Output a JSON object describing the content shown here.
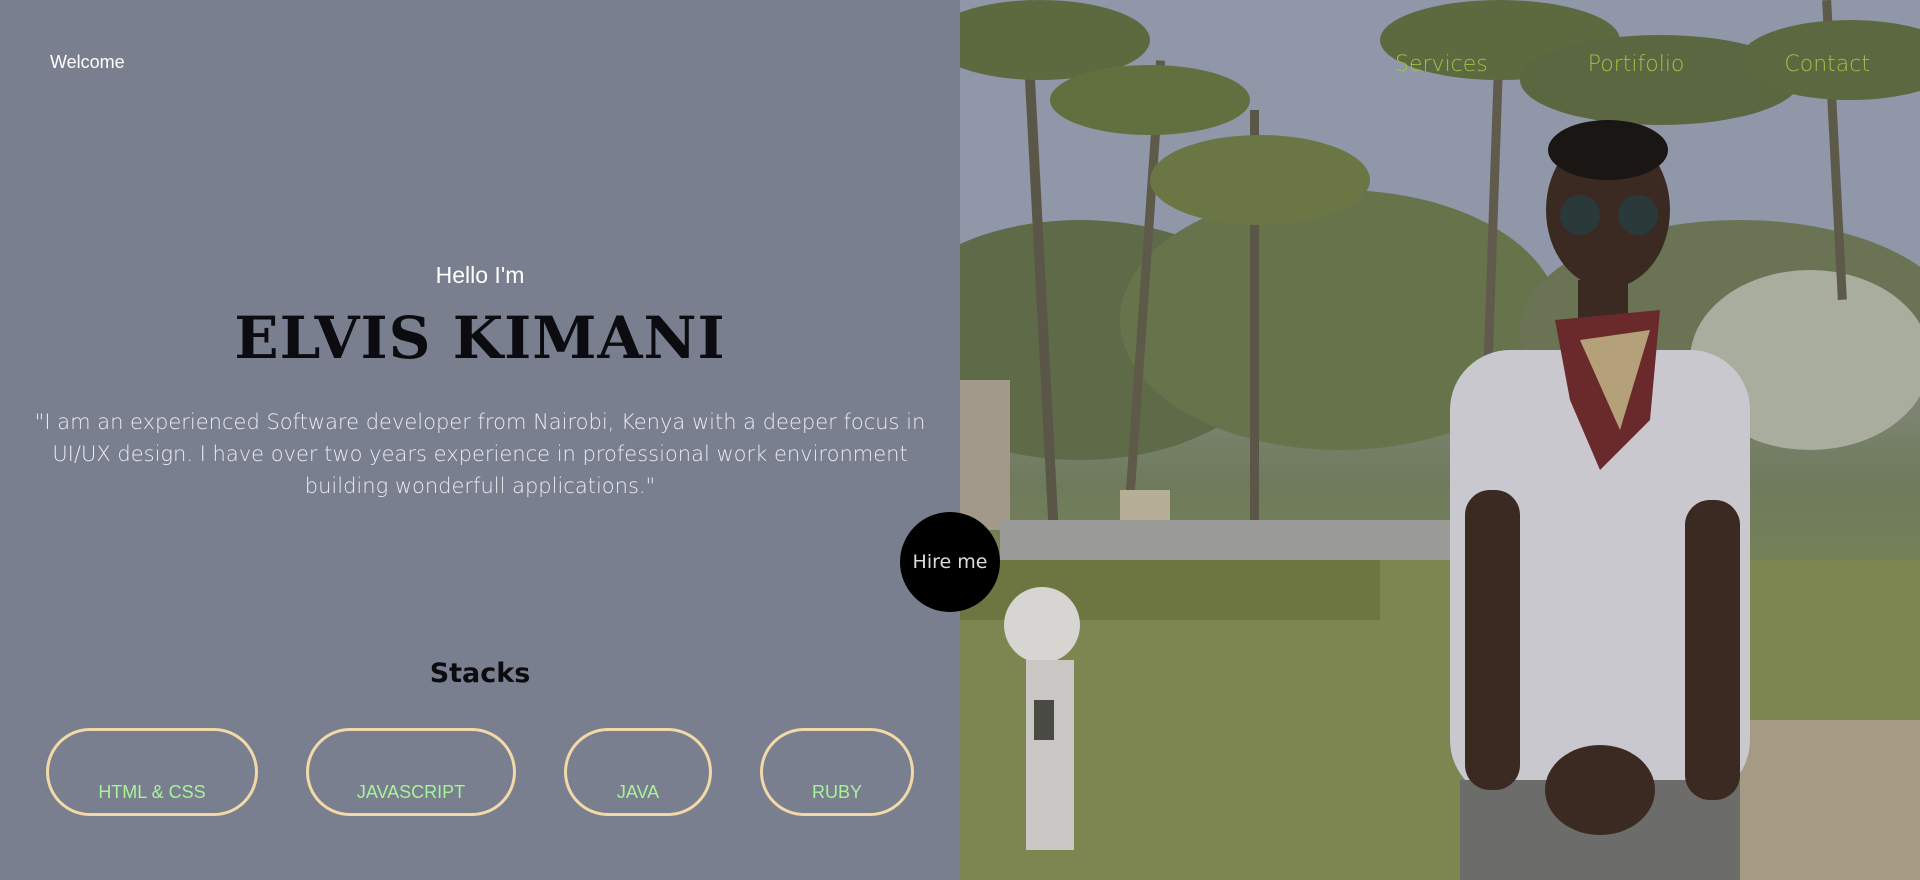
{
  "header": {
    "welcome": "Welcome",
    "nav": [
      {
        "label": "Services"
      },
      {
        "label": "Portifolio"
      },
      {
        "label": "Contact"
      }
    ]
  },
  "hero": {
    "greeting": "Hello I'm",
    "name": "ELVIS KIMANI",
    "bio": "\"I am an experienced Software developer from Nairobi, Kenya with a deeper focus in UI/UX design. I have over two years experience in professional work environment building wonderfull applications.\"",
    "hire_label": "Hire me"
  },
  "stacks": {
    "title": "Stacks",
    "items": [
      {
        "label": "HTML & CSS"
      },
      {
        "label": "JAVASCRIPT"
      },
      {
        "label": "JAVA"
      },
      {
        "label": "RUBY"
      }
    ]
  },
  "colors": {
    "background": "#7a7f8f",
    "nav_text": "#9ec24a",
    "pill_border": "#f3d9a8",
    "pill_text": "#a7f39a",
    "hire_bg": "#000000"
  },
  "photo": {
    "description_icon": "portrait-photo"
  }
}
